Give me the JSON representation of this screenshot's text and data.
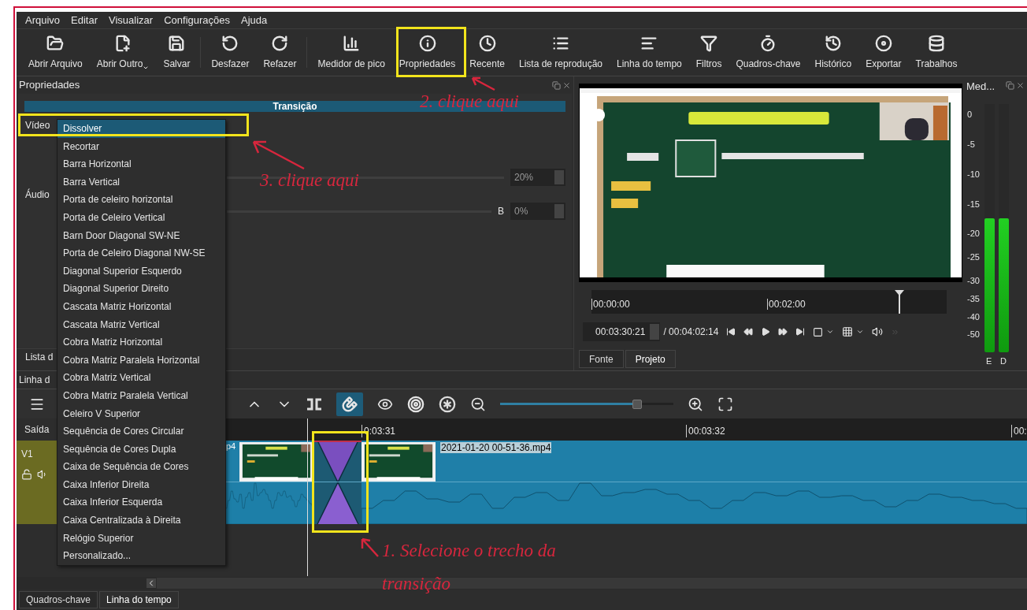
{
  "menu_bar": [
    {
      "label": "Arquivo"
    },
    {
      "label": "Editar"
    },
    {
      "label": "Visualizar"
    },
    {
      "label": "Configurações"
    },
    {
      "label": "Ajuda"
    }
  ],
  "toolbar": [
    {
      "label": "Abrir Arquivo",
      "dropdown": false
    },
    {
      "label": "Abrir Outro",
      "dropdown": true
    },
    {
      "label": "Salvar",
      "dropdown": false
    },
    {
      "label": "Desfazer",
      "dropdown": false
    },
    {
      "label": "Refazer",
      "dropdown": false
    },
    {
      "label": "Medidor de pico",
      "dropdown": false
    },
    {
      "label": "Propriedades",
      "dropdown": false
    },
    {
      "label": "Recente",
      "dropdown": false
    },
    {
      "label": "Lista de reprodução",
      "dropdown": false
    },
    {
      "label": "Linha do tempo",
      "dropdown": false
    },
    {
      "label": "Filtros",
      "dropdown": false
    },
    {
      "label": "Quadros-chave",
      "dropdown": false
    },
    {
      "label": "Histórico",
      "dropdown": false
    },
    {
      "label": "Exportar",
      "dropdown": false
    },
    {
      "label": "Trabalhos",
      "dropdown": false
    }
  ],
  "properties": {
    "title": "Propriedades",
    "section": "Transição",
    "video_label": "Vídeo",
    "audio_label": "Áudio",
    "softness_reading": "20%",
    "balance_label": "B",
    "balance_reading": "0%",
    "bottom_tab": "Lista d"
  },
  "transition_menu": [
    {
      "label": "Dissolver",
      "selected": true
    },
    {
      "label": "Recortar",
      "selected": false
    },
    {
      "label": "Barra Horizontal",
      "selected": false
    },
    {
      "label": "Barra Vertical",
      "selected": false
    },
    {
      "label": "Porta de celeiro horizontal",
      "selected": false
    },
    {
      "label": "Porta de Celeiro Vertical",
      "selected": false
    },
    {
      "label": "Barn Door Diagonal SW-NE",
      "selected": false
    },
    {
      "label": "Porta de Celeiro Diagonal NW-SE",
      "selected": false
    },
    {
      "label": "Diagonal Superior Esquerdo",
      "selected": false
    },
    {
      "label": "Diagonal Superior Direito",
      "selected": false
    },
    {
      "label": "Cascata Matriz Horizontal",
      "selected": false
    },
    {
      "label": "Cascata Matriz Vertical",
      "selected": false
    },
    {
      "label": "Cobra Matriz Horizontal",
      "selected": false
    },
    {
      "label": "Cobra Matriz Paralela Horizontal",
      "selected": false
    },
    {
      "label": "Cobra Matriz Vertical",
      "selected": false
    },
    {
      "label": "Cobra Matriz Paralela Vertical",
      "selected": false
    },
    {
      "label": "Celeiro V Superior",
      "selected": false
    },
    {
      "label": "Sequência de Cores Circular",
      "selected": false
    },
    {
      "label": "Sequência de Cores Dupla",
      "selected": false
    },
    {
      "label": "Caixa de Sequência de Cores",
      "selected": false
    },
    {
      "label": "Caixa Inferior Direita",
      "selected": false
    },
    {
      "label": "Caixa Inferior Esquerda",
      "selected": false
    },
    {
      "label": "Caixa Centralizada à Direita",
      "selected": false
    },
    {
      "label": "Relógio Superior",
      "selected": false
    },
    {
      "label": "Personalizado...",
      "selected": false
    }
  ],
  "preview": {
    "scrubber_labels": [
      "00:00:00",
      "00:02:00"
    ],
    "timecode": "00:03:30:21",
    "duration": "/ 00:04:02:14",
    "tabs": [
      {
        "label": "Fonte",
        "selected": false
      },
      {
        "label": "Projeto",
        "selected": true
      }
    ]
  },
  "meter": {
    "title": "Med...",
    "scale": [
      "0",
      "-5",
      "-10",
      "-15",
      "-20",
      "-25",
      "-30",
      "-35",
      "-40",
      "-50"
    ],
    "channels": [
      {
        "label": "E",
        "level": 0.54
      },
      {
        "label": "D",
        "level": 0.54
      }
    ]
  },
  "timeline": {
    "title": "Linha d",
    "output_label": "Saída",
    "track_label": "V1",
    "snap_selected": true,
    "zoom": {
      "level": 0.79
    },
    "ruler": [
      "0:03:31",
      "00:03:32",
      "00:"
    ],
    "clips": [
      {
        "name": "p4"
      },
      {
        "name": "2021-01-20 00-51-36.mp4"
      }
    ],
    "bottom_tabs": [
      {
        "label": "Quadros-chave",
        "selected": false
      },
      {
        "label": "Linha do tempo",
        "selected": true
      }
    ]
  },
  "annotations": [
    {
      "text": "2. clique aqui"
    },
    {
      "text": "3. clique aqui"
    },
    {
      "text": "1. Selecione o trecho da"
    },
    {
      "text": "transição"
    }
  ]
}
